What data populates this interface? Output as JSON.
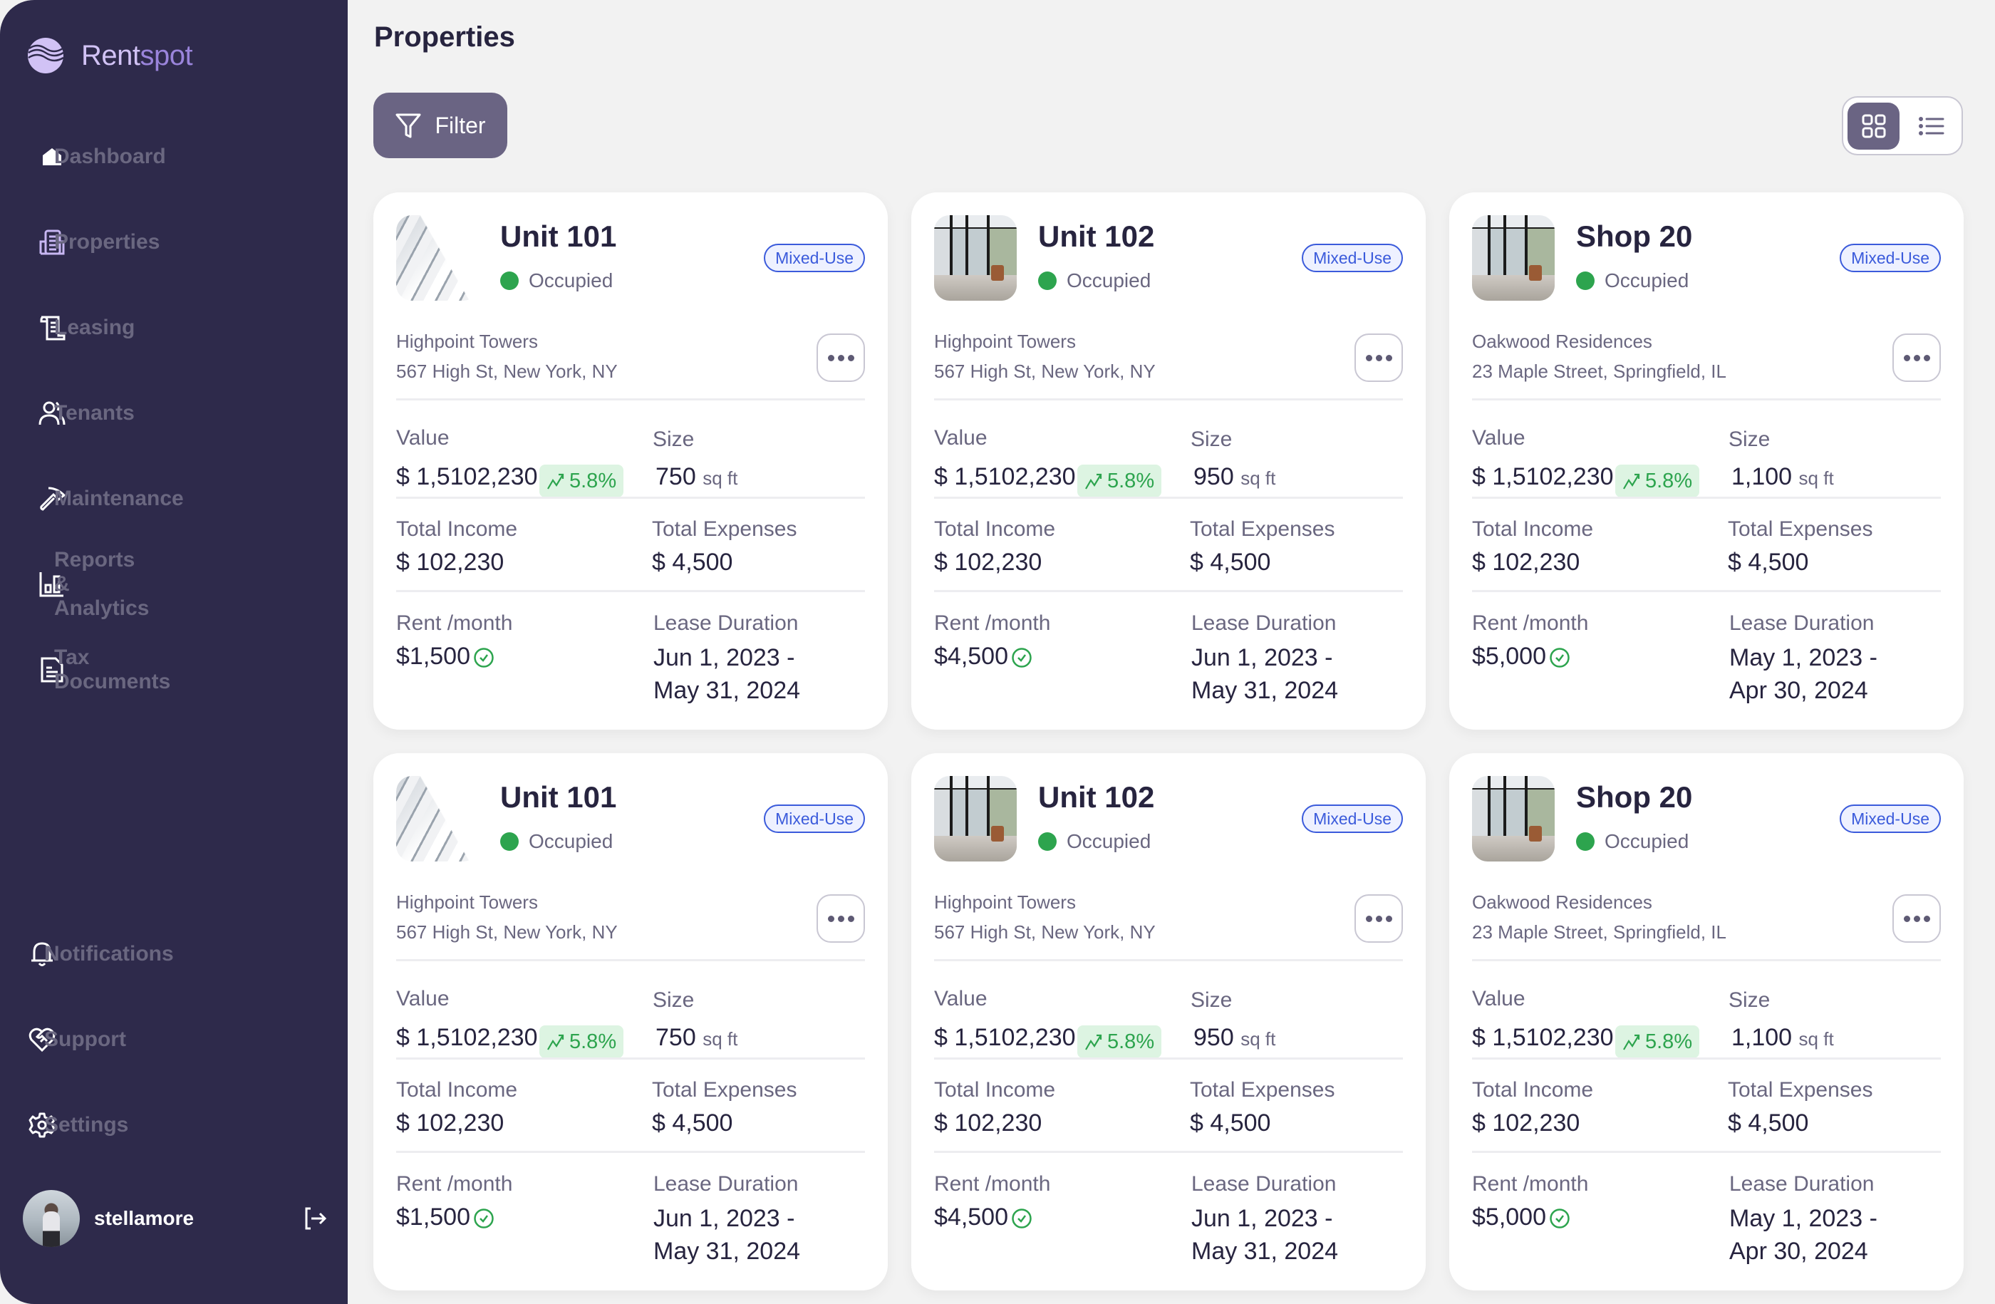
{
  "app": {
    "brand_part1": "Rent",
    "brand_part2": "spot",
    "brand_colors": {
      "light": "#D1C2F5",
      "accent": "#9A84DB"
    }
  },
  "sidebar": {
    "items": [
      {
        "label": "Dashboard",
        "icon": "home-icon",
        "active": false
      },
      {
        "label": "Properties",
        "icon": "building-icon",
        "active": true
      },
      {
        "label": "Leasing",
        "icon": "scroll-icon",
        "active": false
      },
      {
        "label": "Tenants",
        "icon": "users-icon",
        "active": false
      },
      {
        "label": "Maintenance",
        "icon": "hammer-icon",
        "active": false
      },
      {
        "label": "Reports & Analytics",
        "icon": "bar-chart-icon",
        "active": false
      },
      {
        "label": "Tax Documents",
        "icon": "document-icon",
        "active": false
      }
    ],
    "bottom_items": [
      {
        "label": "Notifications",
        "icon": "bell-icon"
      },
      {
        "label": "Support",
        "icon": "heart-handshake-icon"
      },
      {
        "label": "Settings",
        "icon": "gear-icon"
      }
    ],
    "user": {
      "name": "stellamore",
      "logout_icon": "logout-icon"
    }
  },
  "header": {
    "title": "Properties",
    "filter_label": "Filter",
    "view_modes": [
      {
        "name": "grid",
        "icon": "grid-icon",
        "active": true
      },
      {
        "name": "list",
        "icon": "list-icon",
        "active": false
      }
    ]
  },
  "labels": {
    "value": "Value",
    "size": "Size",
    "size_unit": "sq ft",
    "total_income": "Total Income",
    "total_expenses": "Total Expenses",
    "rent_month": "Rent /month",
    "lease_duration": "Lease Duration"
  },
  "properties": [
    {
      "name": "Unit 101",
      "status": "Occupied",
      "type": "Mixed-Use",
      "image": "tower",
      "building": "Highpoint Towers",
      "address": "567 High St, New York, NY",
      "value": "$ 1,5102,230",
      "trend": "5.8%",
      "size": "750",
      "total_income": "$ 102,230",
      "total_expenses": "$ 4,500",
      "rent": "$1,500",
      "lease_start": "Jun 1, 2023 -",
      "lease_end": "May 31, 2024"
    },
    {
      "name": "Unit 102",
      "status": "Occupied",
      "type": "Mixed-Use",
      "image": "room",
      "building": "Highpoint Towers",
      "address": "567 High St, New York, NY",
      "value": "$ 1,5102,230",
      "trend": "5.8%",
      "size": "950",
      "total_income": "$ 102,230",
      "total_expenses": "$ 4,500",
      "rent": "$4,500",
      "lease_start": "Jun 1, 2023 -",
      "lease_end": "May 31, 2024"
    },
    {
      "name": "Shop 20",
      "status": "Occupied",
      "type": "Mixed-Use",
      "image": "room",
      "building": "Oakwood Residences",
      "address": "23 Maple Street, Springfield, IL",
      "value": "$ 1,5102,230",
      "trend": "5.8%",
      "size": "1,100",
      "total_income": "$ 102,230",
      "total_expenses": "$ 4,500",
      "rent": "$5,000",
      "lease_start": "May 1, 2023 -",
      "lease_end": "Apr 30, 2024"
    },
    {
      "name": "Unit 101",
      "status": "Occupied",
      "type": "Mixed-Use",
      "image": "tower",
      "building": "Highpoint Towers",
      "address": "567 High St, New York, NY",
      "value": "$ 1,5102,230",
      "trend": "5.8%",
      "size": "750",
      "total_income": "$ 102,230",
      "total_expenses": "$ 4,500",
      "rent": "$1,500",
      "lease_start": "Jun 1, 2023 -",
      "lease_end": "May 31, 2024"
    },
    {
      "name": "Unit 102",
      "status": "Occupied",
      "type": "Mixed-Use",
      "image": "room",
      "building": "Highpoint Towers",
      "address": "567 High St, New York, NY",
      "value": "$ 1,5102,230",
      "trend": "5.8%",
      "size": "950",
      "total_income": "$ 102,230",
      "total_expenses": "$ 4,500",
      "rent": "$4,500",
      "lease_start": "Jun 1, 2023 -",
      "lease_end": "May 31, 2024"
    },
    {
      "name": "Shop 20",
      "status": "Occupied",
      "type": "Mixed-Use",
      "image": "room",
      "building": "Oakwood Residences",
      "address": "23 Maple Street, Springfield, IL",
      "value": "$ 1,5102,230",
      "trend": "5.8%",
      "size": "1,100",
      "total_income": "$ 102,230",
      "total_expenses": "$ 4,500",
      "rent": "$5,000",
      "lease_start": "May 1, 2023 -",
      "lease_end": "Apr 30, 2024"
    }
  ],
  "colors": {
    "sidebar_bg": "#2E2A4B",
    "primary": "#6A6483",
    "status_green": "#2DA44E",
    "badge_blue": "#3B5BDB",
    "trend_bg": "#DDF4E2"
  }
}
